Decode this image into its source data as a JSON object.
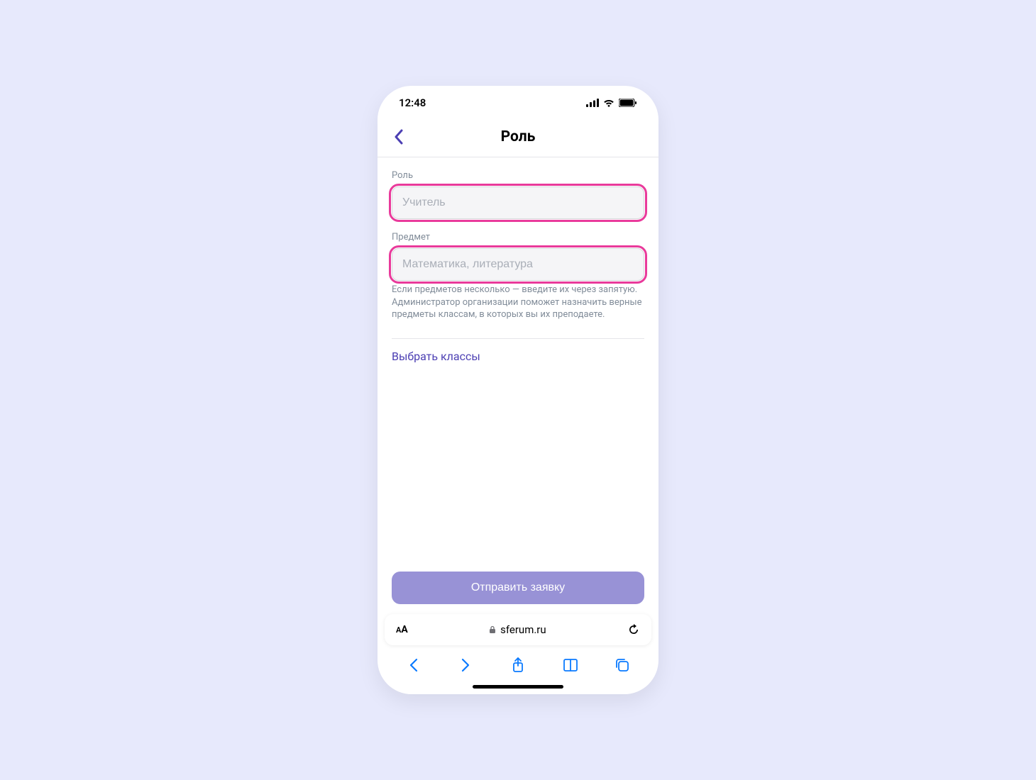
{
  "status": {
    "time": "12:48"
  },
  "header": {
    "title": "Роль"
  },
  "form": {
    "roleLabel": "Роль",
    "rolePlaceholder": "Учитель",
    "subjectLabel": "Предмет",
    "subjectPlaceholder": "Математика, литература",
    "hint": "Если предметов несколько — введите их через запятую. Администратор организации поможет назначить верные предметы классам, в которых вы их преподаете.",
    "chooseClasses": "Выбрать классы",
    "submit": "Отправить заявку"
  },
  "browser": {
    "url": "sferum.ru"
  }
}
